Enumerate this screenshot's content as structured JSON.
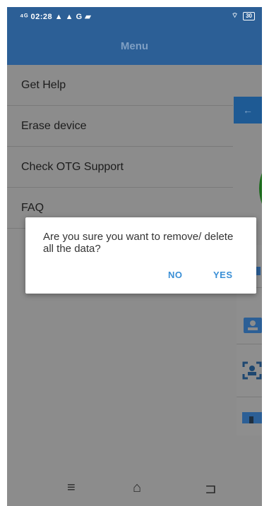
{
  "status_bar": {
    "left_text": "⁴ᴳ 02:28 ▲ ▲ G ▰",
    "right_text": "⌔",
    "battery": "30"
  },
  "header": {
    "title": "Menu"
  },
  "menu": {
    "items": [
      {
        "label": "Get Help"
      },
      {
        "label": "Erase device"
      },
      {
        "label": "Check OTG Support"
      },
      {
        "label": "FAQ"
      }
    ]
  },
  "background_content": {
    "back_arrow": "←",
    "icons": [
      "shapes-icon",
      "contact-card-icon",
      "face-scan-icon",
      "folder-icon"
    ]
  },
  "dialog": {
    "message": "Are you sure you want to remove/ delete all the data?",
    "no_label": "NO",
    "yes_label": "YES"
  },
  "nav_bar": {
    "menu_glyph": "≡",
    "home_glyph": "⌂",
    "back_glyph": "⊐"
  },
  "colors": {
    "header_bg": "#2c5f96",
    "dialog_button": "#3a8fd6",
    "overlay_gray": "#8c8c8c"
  }
}
